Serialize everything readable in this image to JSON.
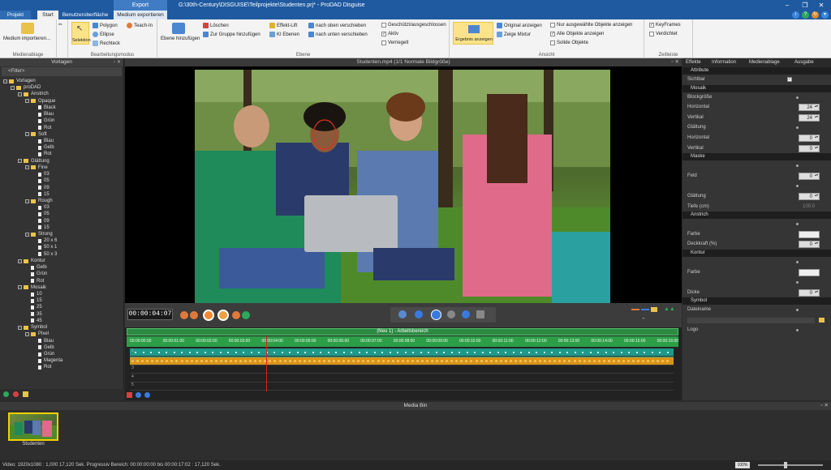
{
  "titlebar": {
    "context_tab": "Export",
    "title": "G:\\30th-Century\\DISGUISE\\Teilprojekte\\Studenten.prj* - ProDAD Disguise"
  },
  "tabs": [
    "Projekt",
    "Start",
    "Benutzeroberfläche",
    "Medium exportieren"
  ],
  "ribbon": {
    "medienablage": {
      "btn": "Medium importieren...",
      "label": "Medienablage"
    },
    "bearbeitung": {
      "selektion": "Selektion",
      "polygon": "Polygon",
      "teach_in": "Teach-In",
      "ellipse": "Ellipse",
      "rechteck": "Rechteck",
      "label": "Bearbeitungsmodus"
    },
    "ebene": {
      "ebene_hinzu": "Ebene hinzufügen",
      "loeschen": "Löschen",
      "gruppe": "Zur Gruppe hinzufügen",
      "effekt_lift": "Effekt-Lift",
      "ki_ebenen": "KI Ebenen",
      "nach_oben": "nach oben verschieben",
      "nach_unten": "nach unten verschieben",
      "geschuetzt": "Geschützt/ausgeschlossen",
      "aktiv": "Aktiv",
      "verriegelt": "Verriegelt",
      "label": "Ebene"
    },
    "ansicht": {
      "ergebnis": "Ergebnis anzeigen",
      "original": "Original anzeigen",
      "mixtur": "Zeige Mixtur",
      "nur_ausgewaehlt": "Nur ausgewählte Objekte anzeigen",
      "alle_objekte": "Alle Objekte anzeigen",
      "solide": "Solide Objekte",
      "label": "Ansicht"
    },
    "zeitleiste": {
      "keyframes": "KeyFrames",
      "verdichtet": "Verdichtet",
      "label": "Zeitleiste"
    }
  },
  "left_panel": {
    "title": "Vorlagen",
    "filter": "<Filter>",
    "tree": [
      {
        "t": "Vorlagen",
        "d": 0,
        "k": "f"
      },
      {
        "t": "proDAD",
        "d": 1,
        "k": "f"
      },
      {
        "t": "Anstrich",
        "d": 2,
        "k": "f"
      },
      {
        "t": "Opaque",
        "d": 3,
        "k": "f"
      },
      {
        "t": "Black",
        "d": 4,
        "k": "d"
      },
      {
        "t": "Blau",
        "d": 4,
        "k": "d"
      },
      {
        "t": "Grün",
        "d": 4,
        "k": "d"
      },
      {
        "t": "Rot",
        "d": 4,
        "k": "d"
      },
      {
        "t": "Soft",
        "d": 3,
        "k": "f"
      },
      {
        "t": "Blau",
        "d": 4,
        "k": "d"
      },
      {
        "t": "Gelb",
        "d": 4,
        "k": "d"
      },
      {
        "t": "Rot",
        "d": 4,
        "k": "d"
      },
      {
        "t": "Glättung",
        "d": 2,
        "k": "f"
      },
      {
        "t": "Fine",
        "d": 3,
        "k": "f"
      },
      {
        "t": "03",
        "d": 4,
        "k": "d"
      },
      {
        "t": "05",
        "d": 4,
        "k": "d"
      },
      {
        "t": "09",
        "d": 4,
        "k": "d"
      },
      {
        "t": "15",
        "d": 4,
        "k": "d"
      },
      {
        "t": "Rough",
        "d": 3,
        "k": "f"
      },
      {
        "t": "03",
        "d": 4,
        "k": "d"
      },
      {
        "t": "05",
        "d": 4,
        "k": "d"
      },
      {
        "t": "09",
        "d": 4,
        "k": "d"
      },
      {
        "t": "15",
        "d": 4,
        "k": "d"
      },
      {
        "t": "Strong",
        "d": 3,
        "k": "f"
      },
      {
        "t": "20 x 6",
        "d": 4,
        "k": "d"
      },
      {
        "t": "50 x 1",
        "d": 4,
        "k": "d"
      },
      {
        "t": "50 x 3",
        "d": 4,
        "k": "d"
      },
      {
        "t": "Kontur",
        "d": 2,
        "k": "f"
      },
      {
        "t": "Gelb",
        "d": 3,
        "k": "d"
      },
      {
        "t": "Grün",
        "d": 3,
        "k": "d"
      },
      {
        "t": "Rot",
        "d": 3,
        "k": "d"
      },
      {
        "t": "Mosaik",
        "d": 2,
        "k": "f"
      },
      {
        "t": "10",
        "d": 3,
        "k": "d"
      },
      {
        "t": "15",
        "d": 3,
        "k": "d"
      },
      {
        "t": "25",
        "d": 3,
        "k": "d"
      },
      {
        "t": "35",
        "d": 3,
        "k": "d"
      },
      {
        "t": "45",
        "d": 3,
        "k": "d"
      },
      {
        "t": "Symbol",
        "d": 2,
        "k": "f"
      },
      {
        "t": "Pixel",
        "d": 3,
        "k": "f"
      },
      {
        "t": "Blau",
        "d": 4,
        "k": "d"
      },
      {
        "t": "Gelb",
        "d": 4,
        "k": "d"
      },
      {
        "t": "Grün",
        "d": 4,
        "k": "d"
      },
      {
        "t": "Magenta",
        "d": 4,
        "k": "d"
      },
      {
        "t": "Rot",
        "d": 4,
        "k": "d"
      }
    ]
  },
  "viewer": {
    "header": "Studenten.mp4   (1/1  Normale Bildgröße)",
    "timecode": "00:00:04:07"
  },
  "timeline": {
    "bar_label": "(Neu 1) - Arbeitsbereich",
    "ticks": [
      "00:00:00:00",
      "00:00:01:00",
      "00:00:02:00",
      "00:00:03:00",
      "00:00:04:00",
      "00:00:05:00",
      "00:00:06:00",
      "00:00:07:00",
      "00:00:08:00",
      "00:00:09:00",
      "00:00:10:00",
      "00:00:11:00",
      "00:00:12:00",
      "00:00:13:00",
      "00:00:14:00",
      "00:00:15:00",
      "00:00:16:00"
    ],
    "row_numbers": [
      "1",
      "2",
      "3",
      "4",
      "5"
    ]
  },
  "right_panel": {
    "tabs": [
      "Effekte",
      "Information",
      "Medienablage",
      "Ausgabe"
    ],
    "attribute": {
      "title": "Attribute",
      "sichtbar": "Sichtbar"
    },
    "mosaik": {
      "title": "Mosaik",
      "blockgroesse": "Blockgröße",
      "horizontal": "Horizontal",
      "horizontal_val": "24",
      "vertikal": "Vertikal",
      "vertikal_val": "24",
      "glaettung": "Glättung",
      "g_horizontal": "Horizontal",
      "g_horizontal_val": "0",
      "g_vertikal": "Vertikal",
      "g_vertikal_val": "0"
    },
    "maske": {
      "title": "Maske",
      "feld": "Feld",
      "feld_val": "0",
      "glaettung": "Glättung",
      "glaettung_val": "0",
      "tiefe": "Tiefe (cm)",
      "tiefe_val": "100.0"
    },
    "anstrich": {
      "title": "Anstrich",
      "farbe": "Farbe",
      "deckkraft": "Deckkraft (%)",
      "deckkraft_val": "0"
    },
    "kontur": {
      "title": "Kontur",
      "farbe": "Farbe",
      "dicke": "Dicke",
      "dicke_val": "0"
    },
    "symbol": {
      "title": "Symbol",
      "dateiname": "Dateiname",
      "logo": "Logo"
    }
  },
  "media_bin": {
    "title": "Media Bin",
    "item_label": "Studenten"
  },
  "status": {
    "text": "Video: 1920x1080 : 1,000   17,120 Sek.  Progressiv   Bereich: 00:00:00:00 bis 00:00:17:02 : 17,120 Sek.",
    "zoom": "100%"
  },
  "colors": {
    "accent": "#1f5aa0",
    "highlight": "#fbe38a",
    "timeline_green": "#2d9e48",
    "track_teal": "#1f9a8a",
    "track_orange": "#d9941a"
  }
}
